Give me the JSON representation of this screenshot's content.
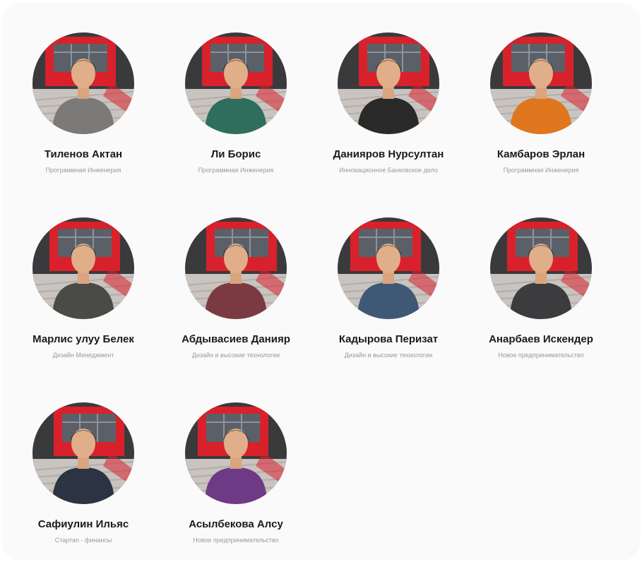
{
  "team": {
    "members": [
      {
        "name": "Тиленов Актан",
        "program": "Программная Инженерия",
        "shirt": "#7c7a78",
        "hair": "#1c1a19"
      },
      {
        "name": "Ли Борис",
        "program": "Программная Инженерия",
        "shirt": "#2f6e5c",
        "hair": "#141414"
      },
      {
        "name": "Данияров Нурсултан",
        "program": "Инновационное Банковское дело",
        "shirt": "#2a2a2a",
        "hair": "#1e1712"
      },
      {
        "name": "Камбаров Эрлан",
        "program": "Программная Инженерия",
        "shirt": "#e0761e",
        "hair": "#2a2320"
      },
      {
        "name": "Марлис улуу Белек",
        "program": "Дизайн Менеджмент",
        "shirt": "#4a4a46",
        "hair": "#161616"
      },
      {
        "name": "Абдывасиев Данияр",
        "program": "Дизайн и высокие технологии",
        "shirt": "#7b3a42",
        "hair": "#121212"
      },
      {
        "name": "Кадырова Перизат",
        "program": "Дизайн и высокие технологии",
        "shirt": "#3f5876",
        "hair": "#2b1c17"
      },
      {
        "name": "Анарбаев Искендер",
        "program": "Новое предпринимательство",
        "shirt": "#3c3c3e",
        "hair": "#1a1716"
      },
      {
        "name": "Сафиулин Ильяс",
        "program": "Стартап - финансы",
        "shirt": "#2c3342",
        "hair": "#1c1714"
      },
      {
        "name": "Асылбекова Алсу",
        "program": "Новое предпринимательство",
        "shirt": "#6e3a86",
        "hair": "#1f1612"
      }
    ]
  },
  "colors": {
    "accent_red": "#d8212b",
    "background": "#fafafa",
    "name_text": "#1a1a1a",
    "program_text": "#9a9a9a"
  }
}
